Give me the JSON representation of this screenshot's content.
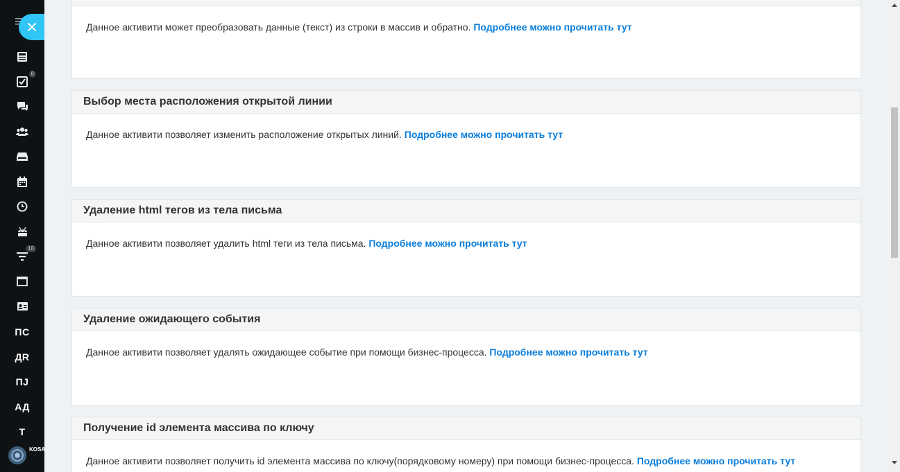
{
  "sidebar": {
    "badges": {
      "tasks": "8",
      "filter": "10"
    },
    "text_items": [
      "ПС",
      "ДR",
      "ПЈ",
      "АД",
      "Т"
    ],
    "user_label": "KOSA ВСЁ Б"
  },
  "cards": [
    {
      "title": "",
      "description": "Данное активити может преобразовать данные (текст) из строки в массив и обратно.",
      "link": "Подробнее можно прочитать тут"
    },
    {
      "title": "Выбор места расположения открытой линии",
      "description": "Данное активити позволяет изменить расположение открытых линий.",
      "link": "Подробнее можно прочитать тут"
    },
    {
      "title": "Удаление html тегов из тела письма",
      "description": "Данное активити позволяет удалить html теги из тела письма.",
      "link": "Подробнее можно прочитать тут"
    },
    {
      "title": "Удаление ожидающего события",
      "description": "Данное активити позволяет удалять ожидающее событие при помощи бизнес-процесса.",
      "link": "Подробнее можно прочитать тут"
    },
    {
      "title": "Получение id элемента массива по ключу",
      "description": "Данное активити позволяет получить id элемента массива по ключу(порядковому номеру) при помощи бизнес-процесса.",
      "link": "Подробнее можно прочитать тут"
    }
  ],
  "colors": {
    "accent": "#2fc6f6",
    "link": "#0a7ddb",
    "sidebar": "#0f1215"
  }
}
